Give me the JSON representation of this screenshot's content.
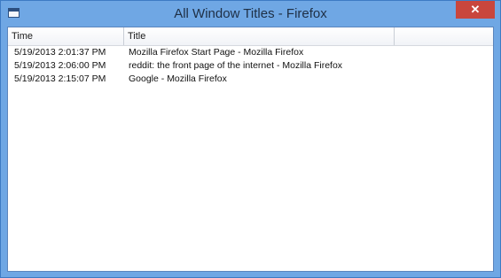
{
  "window": {
    "title": "All Window Titles - Firefox",
    "close_label": "✕"
  },
  "table": {
    "columns": [
      "Time",
      "Title"
    ],
    "rows": [
      {
        "time": "5/19/2013 2:01:37 PM",
        "title": "Mozilla Firefox Start Page - Mozilla Firefox"
      },
      {
        "time": "5/19/2013 2:06:00 PM",
        "title": "reddit: the front page of the internet - Mozilla Firefox"
      },
      {
        "time": "5/19/2013 2:15:07 PM",
        "title": "Google - Mozilla Firefox"
      }
    ]
  },
  "colors": {
    "frame": "#6fa7e4",
    "close_button": "#c9463d"
  },
  "icons": {
    "app": "window-icon",
    "close": "close-icon"
  }
}
